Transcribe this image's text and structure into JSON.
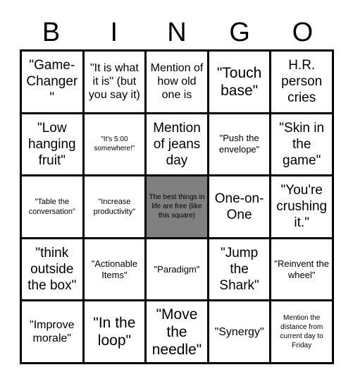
{
  "card": {
    "title": "BINGO",
    "header_letters": [
      "B",
      "I",
      "N",
      "G",
      "O"
    ],
    "free_space_color": "#808080",
    "grid_color": "#000000",
    "background_color": "#ffffff",
    "columns": 5,
    "rows": 5
  },
  "cells": [
    {
      "text": "\"Game-Changer\"",
      "size": "lg",
      "free": false
    },
    {
      "text": "\"It is what it is\" (but you say it)",
      "size": "md",
      "free": false
    },
    {
      "text": "Mention of how old one is",
      "size": "md",
      "free": false
    },
    {
      "text": "\"Touch base\"",
      "size": "xl",
      "free": false
    },
    {
      "text": "H.R. person cries",
      "size": "lg",
      "free": false
    },
    {
      "text": "\"Low hanging fruit\"",
      "size": "lg",
      "free": false
    },
    {
      "text": "\"It's 5:00 somewhere!\"",
      "size": "xxs",
      "free": false
    },
    {
      "text": "Mention of jeans day",
      "size": "lg",
      "free": false
    },
    {
      "text": "\"Push the envelope\"",
      "size": "sm",
      "free": false
    },
    {
      "text": "\"Skin in the game\"",
      "size": "lg",
      "free": false
    },
    {
      "text": "\"Table the conversation\"",
      "size": "xs",
      "free": false
    },
    {
      "text": "\"Increase productivity\"",
      "size": "xs",
      "free": false
    },
    {
      "text": "The best things in life are free (like this square)",
      "size": "xxs",
      "free": true
    },
    {
      "text": "One-on-One",
      "size": "lg",
      "free": false
    },
    {
      "text": "\"You're crushing it.\"",
      "size": "lg",
      "free": false
    },
    {
      "text": "\"think outside the box\"",
      "size": "lg",
      "free": false
    },
    {
      "text": "\"Actionable Items\"",
      "size": "sm",
      "free": false
    },
    {
      "text": "\"Paradigm\"",
      "size": "sm",
      "free": false
    },
    {
      "text": "\"Jump the Shark\"",
      "size": "lg",
      "free": false
    },
    {
      "text": "\"Reinvent the wheel\"",
      "size": "sm",
      "free": false
    },
    {
      "text": "\"Improve morale\"",
      "size": "md",
      "free": false
    },
    {
      "text": "\"In the loop\"",
      "size": "xl",
      "free": false
    },
    {
      "text": "\"Move the needle\"",
      "size": "xl",
      "free": false
    },
    {
      "text": "\"Synergy\"",
      "size": "md",
      "free": false
    },
    {
      "text": "Mention the distance from current day to Friday",
      "size": "xxs",
      "free": false
    }
  ]
}
